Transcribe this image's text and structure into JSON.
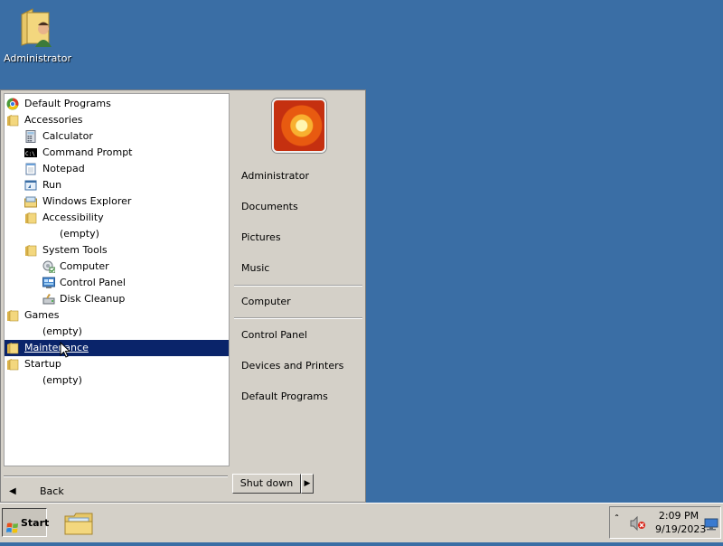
{
  "desktop": {
    "icons": [
      {
        "label": "Administrator",
        "icon": "user-folder-icon"
      }
    ]
  },
  "start_menu": {
    "programs": [
      {
        "label": "Default Programs",
        "icon": "default-programs-icon"
      },
      {
        "label": "Accessories",
        "icon": "folder-icon"
      },
      {
        "label": "Calculator",
        "icon": "calculator-icon"
      },
      {
        "label": "Command Prompt",
        "icon": "command-prompt-icon"
      },
      {
        "label": "Notepad",
        "icon": "notepad-icon"
      },
      {
        "label": "Run",
        "icon": "run-icon"
      },
      {
        "label": "Windows Explorer",
        "icon": "explorer-icon"
      },
      {
        "label": "Accessibility",
        "icon": "folder-icon"
      },
      {
        "label": "(empty)",
        "icon": ""
      },
      {
        "label": "System Tools",
        "icon": "folder-icon"
      },
      {
        "label": "Computer",
        "icon": "computer-icon"
      },
      {
        "label": "Control Panel",
        "icon": "control-panel-icon"
      },
      {
        "label": "Disk Cleanup",
        "icon": "disk-cleanup-icon"
      },
      {
        "label": "Games",
        "icon": "folder-icon"
      },
      {
        "label": "(empty)",
        "icon": ""
      },
      {
        "label": "Maintenance",
        "icon": "folder-icon",
        "selected": true
      },
      {
        "label": "Startup",
        "icon": "folder-icon"
      },
      {
        "label": "(empty)",
        "icon": ""
      }
    ],
    "back_label": "Back",
    "right_items": [
      "Administrator",
      "Documents",
      "Pictures",
      "Music",
      "Computer",
      "Control Panel",
      "Devices and Printers",
      "Default Programs"
    ],
    "shutdown_label": "Shut down"
  },
  "taskbar": {
    "start_label": "Start",
    "pinned": [
      {
        "icon": "windows-explorer-icon"
      }
    ],
    "clock": {
      "time": "2:09 PM",
      "date": "9/19/2023"
    }
  },
  "colors": {
    "desktop": "#3a6ea5",
    "selection": "#0a246a",
    "menu_face": "#d4d0c8"
  }
}
